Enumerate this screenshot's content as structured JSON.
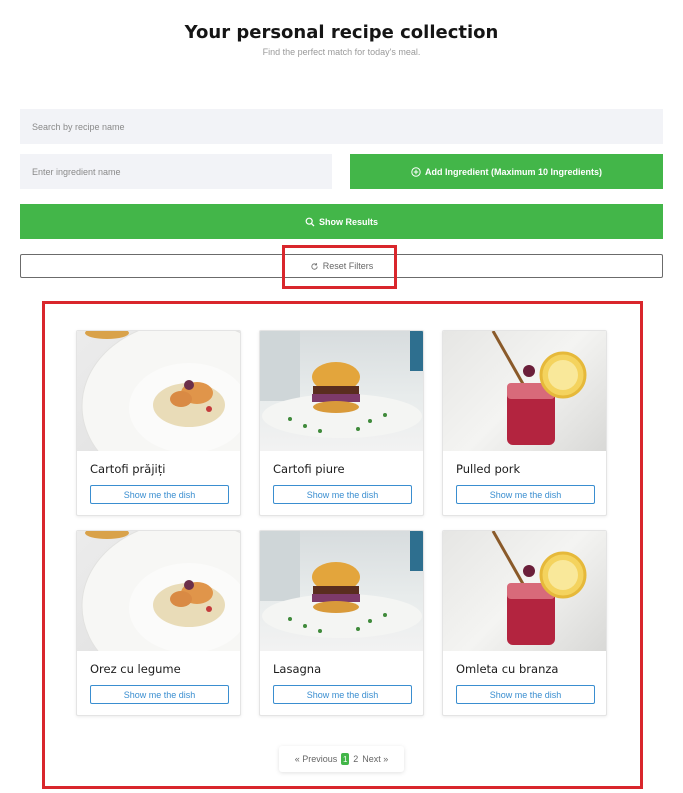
{
  "header": {
    "title": "Your personal recipe collection",
    "subtitle": "Find the perfect match for today's meal."
  },
  "search": {
    "placeholder": "Search by recipe name",
    "value": ""
  },
  "ingredient": {
    "placeholder": "Enter ingredient name",
    "value": ""
  },
  "buttons": {
    "add_ingredient": "Add Ingredient (Maximum 10 Ingredients)",
    "show_results": "Show Results",
    "reset_filters": "Reset Filters"
  },
  "recipes": [
    {
      "name": "Cartofi prăjiți",
      "button": "Show me the dish",
      "photo": "plated-dish"
    },
    {
      "name": "Cartofi piure",
      "button": "Show me the dish",
      "photo": "burger"
    },
    {
      "name": "Pulled pork",
      "button": "Show me the dish",
      "photo": "berry-drink"
    },
    {
      "name": "Orez cu legume",
      "button": "Show me the dish",
      "photo": "plated-dish"
    },
    {
      "name": "Lasagna",
      "button": "Show me the dish",
      "photo": "burger"
    },
    {
      "name": "Omleta cu branza",
      "button": "Show me the dish",
      "photo": "berry-drink"
    }
  ],
  "pagination": {
    "previous": "« Previous",
    "current": "1",
    "next_page": "2",
    "next": "Next »"
  },
  "colors": {
    "accent_green": "#43b649",
    "link_blue": "#3a8ed0",
    "highlight_red": "#d9262c",
    "input_bg": "#f2f3f7"
  }
}
